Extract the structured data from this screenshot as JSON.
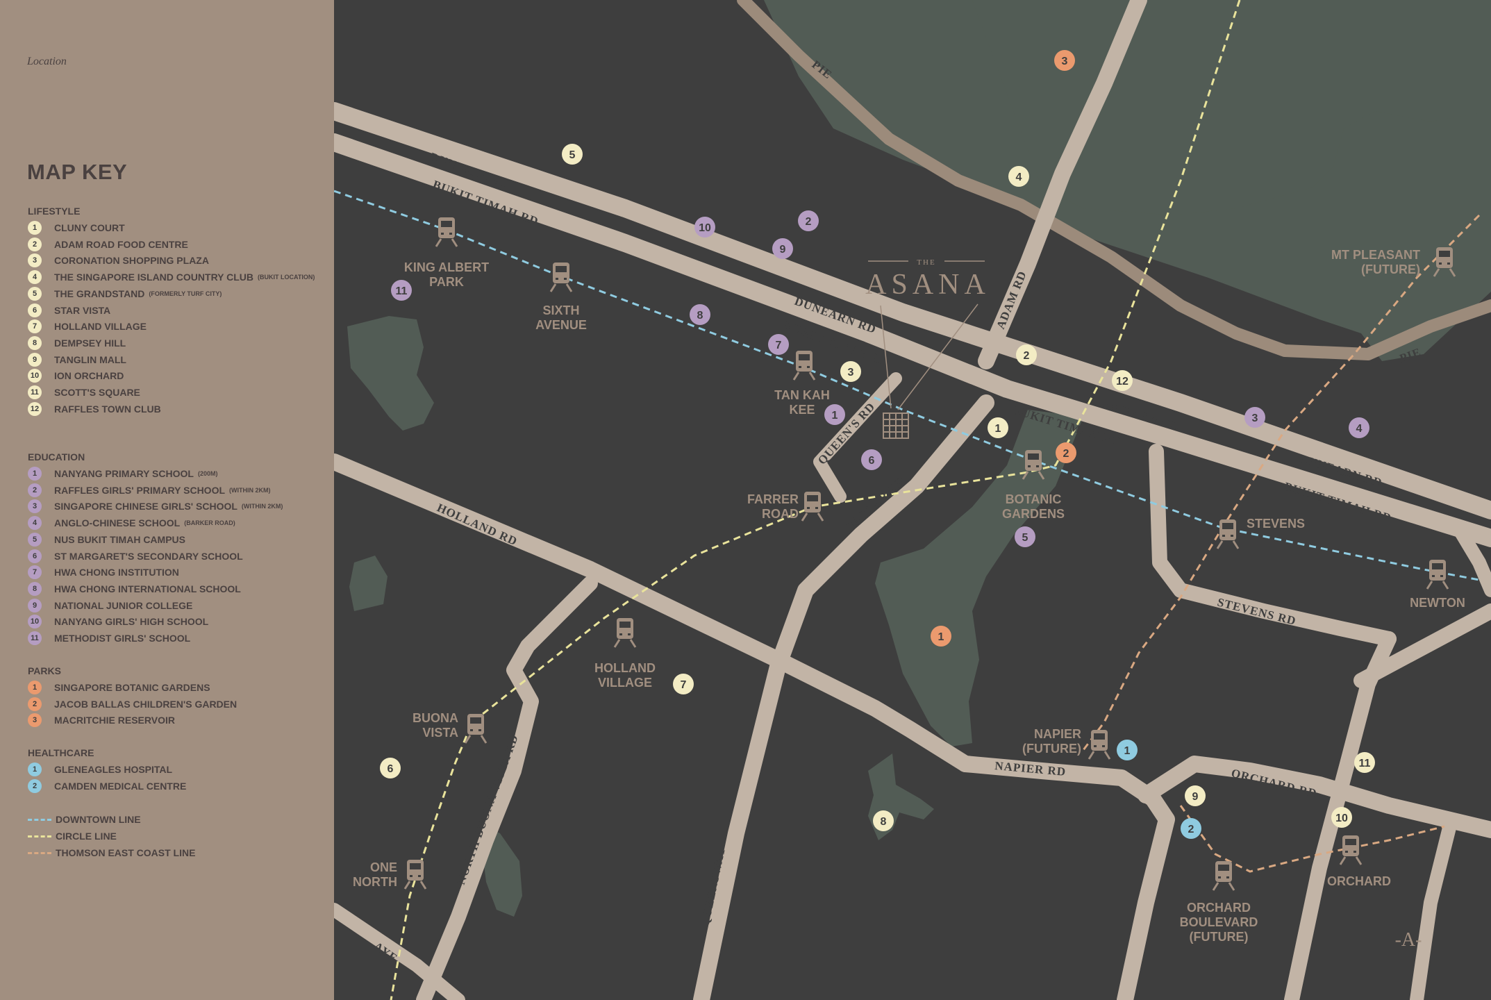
{
  "sidebar": {
    "location_label": "Location",
    "key_title": "MAP KEY",
    "sections": [
      {
        "title": "LIFESTYLE",
        "color": "#f3ecc4",
        "items": [
          {
            "n": "1",
            "label": "CLUNY COURT",
            "sub": ""
          },
          {
            "n": "2",
            "label": "ADAM ROAD FOOD CENTRE",
            "sub": ""
          },
          {
            "n": "3",
            "label": "CORONATION SHOPPING PLAZA",
            "sub": ""
          },
          {
            "n": "4",
            "label": "THE SINGAPORE ISLAND COUNTRY CLUB",
            "sub": "(BUKIT LOCATION)"
          },
          {
            "n": "5",
            "label": "THE GRANDSTAND",
            "sub": "(FORMERLY TURF CITY)"
          },
          {
            "n": "6",
            "label": "STAR VISTA",
            "sub": ""
          },
          {
            "n": "7",
            "label": "HOLLAND VILLAGE",
            "sub": ""
          },
          {
            "n": "8",
            "label": "DEMPSEY HILL",
            "sub": ""
          },
          {
            "n": "9",
            "label": "TANGLIN MALL",
            "sub": ""
          },
          {
            "n": "10",
            "label": "ION ORCHARD",
            "sub": ""
          },
          {
            "n": "11",
            "label": "SCOTT'S SQUARE",
            "sub": ""
          },
          {
            "n": "12",
            "label": "RAFFLES TOWN CLUB",
            "sub": ""
          }
        ]
      },
      {
        "title": "EDUCATION",
        "color": "#b59dc2",
        "items": [
          {
            "n": "1",
            "label": "NANYANG PRIMARY SCHOOL",
            "sub": "(200M)"
          },
          {
            "n": "2",
            "label": "RAFFLES GIRLS' PRIMARY SCHOOL",
            "sub": "(WITHIN 2KM)"
          },
          {
            "n": "3",
            "label": "SINGAPORE CHINESE GIRLS' SCHOOL",
            "sub": "(WITHIN 2KM)"
          },
          {
            "n": "4",
            "label": "ANGLO-CHINESE SCHOOL",
            "sub": "(BARKER ROAD)"
          },
          {
            "n": "5",
            "label": "NUS BUKIT TIMAH CAMPUS",
            "sub": ""
          },
          {
            "n": "6",
            "label": "ST MARGARET'S SECONDARY SCHOOL",
            "sub": ""
          },
          {
            "n": "7",
            "label": "HWA CHONG INSTITUTION",
            "sub": ""
          },
          {
            "n": "8",
            "label": "HWA CHONG INTERNATIONAL SCHOOL",
            "sub": ""
          },
          {
            "n": "9",
            "label": "NATIONAL JUNIOR COLLEGE",
            "sub": ""
          },
          {
            "n": "10",
            "label": "NANYANG GIRLS' HIGH SCHOOL",
            "sub": ""
          },
          {
            "n": "11",
            "label": "METHODIST GIRLS' SCHOOL",
            "sub": ""
          }
        ]
      },
      {
        "title": "PARKS",
        "color": "#eb9a6e",
        "items": [
          {
            "n": "1",
            "label": "SINGAPORE BOTANIC GARDENS",
            "sub": ""
          },
          {
            "n": "2",
            "label": "JACOB BALLAS CHILDREN'S GARDEN",
            "sub": ""
          },
          {
            "n": "3",
            "label": "MACRITCHIE RESERVOIR",
            "sub": ""
          }
        ]
      },
      {
        "title": "HEALTHCARE",
        "color": "#8fcbe0",
        "items": [
          {
            "n": "1",
            "label": "GLENEAGLES HOSPITAL",
            "sub": ""
          },
          {
            "n": "2",
            "label": "CAMDEN MEDICAL CENTRE",
            "sub": ""
          }
        ]
      }
    ],
    "lines": [
      {
        "label": "DOWNTOWN LINE",
        "color": "#8fcbe0"
      },
      {
        "label": "CIRCLE LINE",
        "color": "#e9e39b"
      },
      {
        "label": "THOMSON EAST COAST LINE",
        "color": "#d9a882"
      }
    ]
  },
  "map": {
    "logo": {
      "pre": "THE",
      "name": "ASANA"
    },
    "corner_mark": "-A-",
    "roads": {
      "dunearn_rd": "DUNEARN RD",
      "bukit_timah_rd": "BUKIT TIMAH RD",
      "pie": "PIE",
      "adam_rd": "ADAM RD",
      "queens_rd": "QUEEN'S RD",
      "farrer_rd": "FARRER RD",
      "holland_rd": "HOLLAND RD",
      "north_buona_vista_rd": "NORTH BUONA VISTA RD",
      "queensway": "QUEENSWAY",
      "napier_rd": "NAPIER RD",
      "orchard_rd": "ORCHARD RD",
      "stevens_rd": "STEVENS RD",
      "aye": "AYE"
    },
    "stations": {
      "king_albert_park": [
        "KING ALBERT",
        "PARK"
      ],
      "sixth_avenue": [
        "SIXTH",
        "AVENUE"
      ],
      "tan_kah_kee": [
        "TAN KAH",
        "KEE"
      ],
      "farrer_road": [
        "FARRER",
        "ROAD"
      ],
      "botanic_gardens": [
        "BOTANIC",
        "GARDENS"
      ],
      "stevens": [
        "STEVENS"
      ],
      "newton": [
        "NEWTON"
      ],
      "mt_pleasant": [
        "MT PLEASANT",
        "(FUTURE)"
      ],
      "holland_village": [
        "HOLLAND",
        "VILLAGE"
      ],
      "buona_vista": [
        "BUONA",
        "VISTA"
      ],
      "one_north": [
        "ONE",
        "NORTH"
      ],
      "napier": [
        "NAPIER",
        "(FUTURE)"
      ],
      "orchard_boulevard": [
        "ORCHARD",
        "BOULEVARD",
        "(FUTURE)"
      ],
      "orchard": [
        "ORCHARD"
      ]
    }
  }
}
